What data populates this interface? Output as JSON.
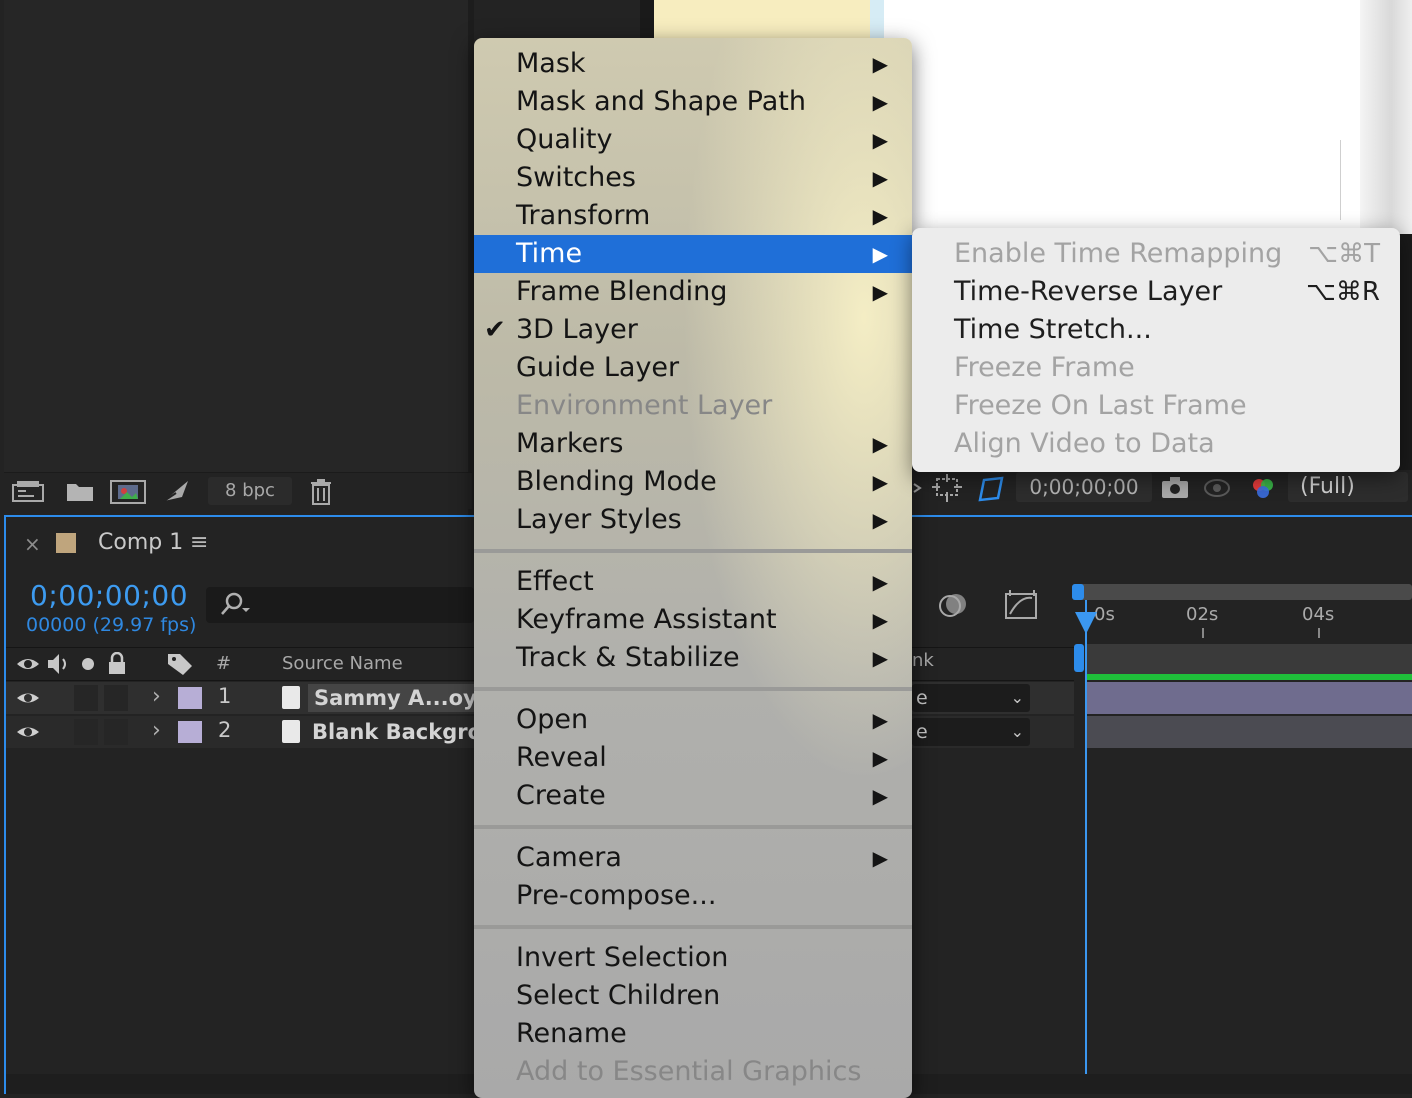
{
  "project_panel": {
    "bpc_label": "8 bpc"
  },
  "viewer_toolbar": {
    "timecode": "0;00;00;00",
    "resolution": "(Full)"
  },
  "timeline": {
    "tab_close": "×",
    "tab_label": "Comp 1",
    "tab_menu": "≡",
    "current_time": "0;00;00;00",
    "frame_info": "00000 (29.97 fps)",
    "columns": {
      "number": "#",
      "source_name": "Source Name",
      "track": "nk"
    },
    "layers": [
      {
        "number": "1",
        "name": "Sammy A...oyer",
        "mode": "e"
      },
      {
        "number": "2",
        "name": "Blank Backgrou",
        "mode": "e"
      }
    ],
    "ruler_labels": [
      "0s",
      "02s",
      "04s"
    ]
  },
  "context_menu": {
    "items": [
      {
        "label": "Mask",
        "submenu": true
      },
      {
        "label": "Mask and Shape Path",
        "submenu": true
      },
      {
        "label": "Quality",
        "submenu": true
      },
      {
        "label": "Switches",
        "submenu": true
      },
      {
        "label": "Transform",
        "submenu": true
      },
      {
        "label": "Time",
        "submenu": true,
        "selected": true
      },
      {
        "label": "Frame Blending",
        "submenu": true
      },
      {
        "label": "3D Layer",
        "checked": true
      },
      {
        "label": "Guide Layer"
      },
      {
        "label": "Environment Layer",
        "disabled": true
      },
      {
        "label": "Markers",
        "submenu": true
      },
      {
        "label": "Blending Mode",
        "submenu": true
      },
      {
        "label": "Layer Styles",
        "submenu": true
      },
      {
        "label": "Effect",
        "submenu": true
      },
      {
        "label": "Keyframe Assistant",
        "submenu": true
      },
      {
        "label": "Track & Stabilize",
        "submenu": true
      },
      {
        "label": "Open",
        "submenu": true
      },
      {
        "label": "Reveal",
        "submenu": true
      },
      {
        "label": "Create",
        "submenu": true
      },
      {
        "label": "Camera",
        "submenu": true
      },
      {
        "label": "Pre-compose..."
      },
      {
        "label": "Invert Selection"
      },
      {
        "label": "Select Children"
      },
      {
        "label": "Rename"
      },
      {
        "label": "Add to Essential Graphics",
        "disabled": true
      }
    ],
    "check_glyph": "✔",
    "arrow_glyph": "▶"
  },
  "time_submenu": {
    "items": [
      {
        "label": "Enable Time Remapping",
        "shortcut": "⌥⌘T",
        "disabled": true
      },
      {
        "label": "Time-Reverse Layer",
        "shortcut": "⌥⌘R"
      },
      {
        "label": "Time Stretch..."
      },
      {
        "label": "Freeze Frame",
        "disabled": true
      },
      {
        "label": "Freeze On Last Frame",
        "disabled": true
      },
      {
        "label": "Align Video to Data",
        "disabled": true
      }
    ]
  },
  "colors": {
    "accent": "#2d8ceb",
    "menu_highlight": "#1f6fd8",
    "layer_label": "#b7aed6",
    "comp_swatch": "#bfa57d"
  }
}
